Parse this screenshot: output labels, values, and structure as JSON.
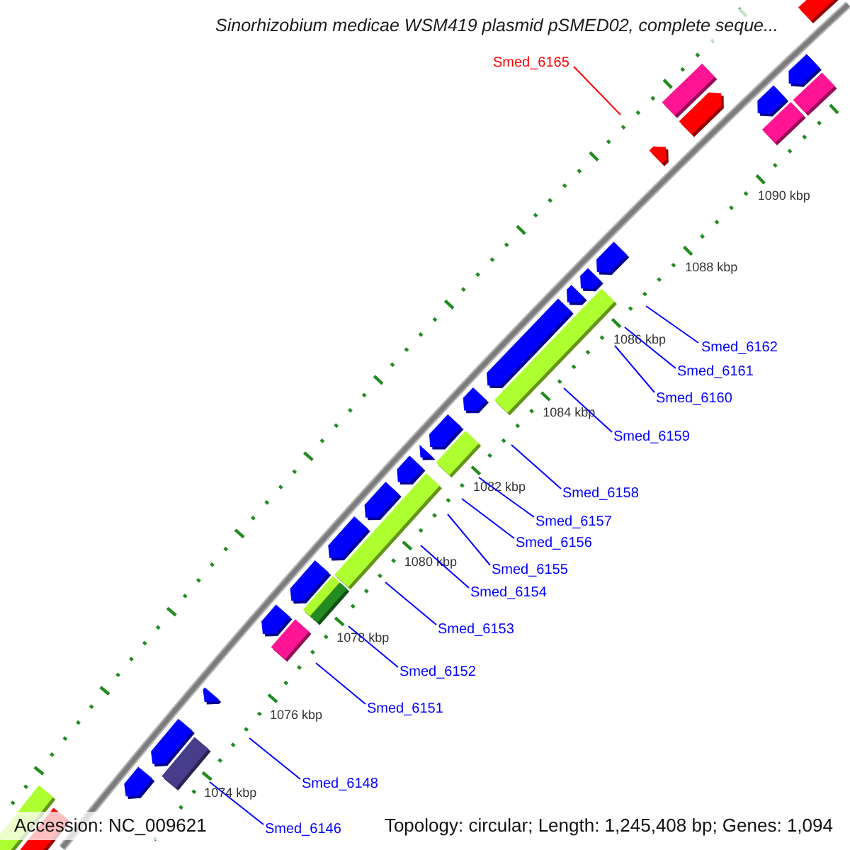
{
  "title": "Sinorhizobium medicae WSM419 plasmid pSMED02, complete seque...",
  "map": {
    "features": [
      {
        "kind": "forward",
        "color": "#ff0000"
      },
      {
        "kind": "block",
        "color": "#ff1493"
      },
      {
        "kind": "forward",
        "color": "#ff0000"
      },
      {
        "kind": "forward",
        "color": "#ff0000"
      },
      {
        "kind": "reverse",
        "color": "#0000ff"
      },
      {
        "kind": "block",
        "color": "#ff1493"
      },
      {
        "kind": "reverse",
        "color": "#0000ff"
      },
      {
        "kind": "block",
        "color": "#ff1493"
      },
      {
        "kind": "reverse",
        "color": "#0000ff"
      },
      {
        "kind": "reverse",
        "color": "#0000ff"
      },
      {
        "kind": "reverse",
        "color": "#0000ff"
      },
      {
        "kind": "block",
        "color": "#adff2f"
      },
      {
        "kind": "reverse",
        "color": "#0000ff"
      },
      {
        "kind": "reverse",
        "color": "#0000ff"
      },
      {
        "kind": "block",
        "color": "#adff2f"
      },
      {
        "kind": "reverse",
        "color": "#0000ff"
      },
      {
        "kind": "reverse",
        "color": "#0000ff"
      },
      {
        "kind": "reverse",
        "color": "#0000ff"
      },
      {
        "kind": "block",
        "color": "#adff2f"
      },
      {
        "kind": "reverse",
        "color": "#0000ff"
      },
      {
        "kind": "reverse",
        "color": "#0000ff"
      },
      {
        "kind": "block",
        "color": "#adff2f"
      },
      {
        "kind": "block",
        "color": "#228b22"
      },
      {
        "kind": "reverse",
        "color": "#0000ff"
      },
      {
        "kind": "block",
        "color": "#ff1493"
      },
      {
        "kind": "reverse",
        "color": "#0000ff"
      },
      {
        "kind": "reverse",
        "color": "#0000ff"
      },
      {
        "kind": "reverse",
        "color": "#0000ff"
      },
      {
        "kind": "block",
        "color": "#483d8b"
      },
      {
        "kind": "reverse",
        "color": "#0000ff"
      },
      {
        "kind": "block",
        "color": "#adff2f"
      },
      {
        "kind": "block",
        "color": "#ff0000"
      }
    ],
    "scale_labels": [
      "1074 kbp",
      "1076 kbp",
      "1078 kbp",
      "1080 kbp",
      "1082 kbp",
      "1084 kbp",
      "1086 kbp",
      "1088 kbp",
      "1090 kbp"
    ],
    "gene_labels": [
      {
        "text": "Smed_6165",
        "color": "#ff0000"
      },
      {
        "text": "Smed_6162",
        "color": "#0000ff"
      },
      {
        "text": "Smed_6161",
        "color": "#0000ff"
      },
      {
        "text": "Smed_6160",
        "color": "#0000ff"
      },
      {
        "text": "Smed_6159",
        "color": "#0000ff"
      },
      {
        "text": "Smed_6158",
        "color": "#0000ff"
      },
      {
        "text": "Smed_6157",
        "color": "#0000ff"
      },
      {
        "text": "Smed_6156",
        "color": "#0000ff"
      },
      {
        "text": "Smed_6155",
        "color": "#0000ff"
      },
      {
        "text": "Smed_6154",
        "color": "#0000ff"
      },
      {
        "text": "Smed_6153",
        "color": "#0000ff"
      },
      {
        "text": "Smed_6152",
        "color": "#0000ff"
      },
      {
        "text": "Smed_6151",
        "color": "#0000ff"
      },
      {
        "text": "Smed_6148",
        "color": "#0000ff"
      },
      {
        "text": "Smed_6146",
        "color": "#0000ff"
      }
    ]
  },
  "footer": {
    "accession": "Accession: NC_009621",
    "summary": "Topology: circular; Length: 1,245,408 bp; Genes: 1,094"
  }
}
